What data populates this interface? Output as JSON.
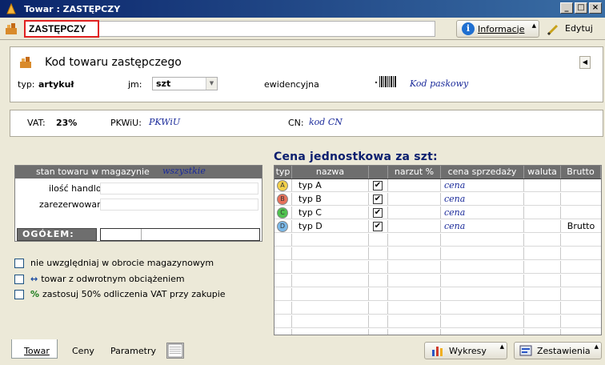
{
  "window": {
    "title": "Towar : ZASTĘPCZY"
  },
  "toolbar": {
    "name": "ZASTĘPCZY",
    "info_label": "Informacje",
    "edit_label": "Edytuj"
  },
  "product": {
    "code_title": "Kod towaru zastępczego",
    "type_label": "typ:",
    "type_value": "artykuł",
    "unit_label": "jm:",
    "unit_value": "szt",
    "evidence_label": "ewidencyjna",
    "barcode_value": "Kod paskowy"
  },
  "tax": {
    "vat_label": "VAT:",
    "vat_value": "23%",
    "pkwiu_label": "PKWiU:",
    "pkwiu_value": "PKWiU",
    "cn_label": "CN:",
    "cn_value": "kod CN"
  },
  "stock": {
    "header": "stan towaru w magazynie",
    "warehouse": "wszystkie",
    "row1_label": "ilość handlowa:",
    "row2_label": "zarezerwowane:",
    "total_label": "OGÓŁEM:"
  },
  "options": [
    {
      "label": "nie uwzględniaj w obrocie magazynowym",
      "icon": ""
    },
    {
      "label": "towar z odwrotnym obciążeniem",
      "icon": "↔"
    },
    {
      "label": "zastosuj 50% odliczenia VAT przy zakupie",
      "icon": "%"
    }
  ],
  "prices": {
    "title": "Cena jednostkowa za szt:",
    "headers": [
      "typ",
      "nazwa",
      "",
      "narzut %",
      "cena sprzedaży",
      "waluta",
      "Brutto"
    ],
    "rows": [
      {
        "badge": "A",
        "color": "#f2d04a",
        "name": "typ A",
        "checked": "✔",
        "price": "cena",
        "gross": ""
      },
      {
        "badge": "B",
        "color": "#e8705a",
        "name": "typ B",
        "checked": "✔",
        "price": "cena",
        "gross": ""
      },
      {
        "badge": "C",
        "color": "#4ec24e",
        "name": "typ C",
        "checked": "✔",
        "price": "cena",
        "gross": ""
      },
      {
        "badge": "D",
        "color": "#7ab8e8",
        "name": "typ D",
        "checked": "✔",
        "price": "cena",
        "gross": "Brutto"
      }
    ]
  },
  "tabs": {
    "towar": "Towar",
    "ceny": "Ceny",
    "parametry": "Parametry"
  },
  "bottom_buttons": {
    "charts": "Wykresy",
    "reports": "Zestawienia"
  }
}
